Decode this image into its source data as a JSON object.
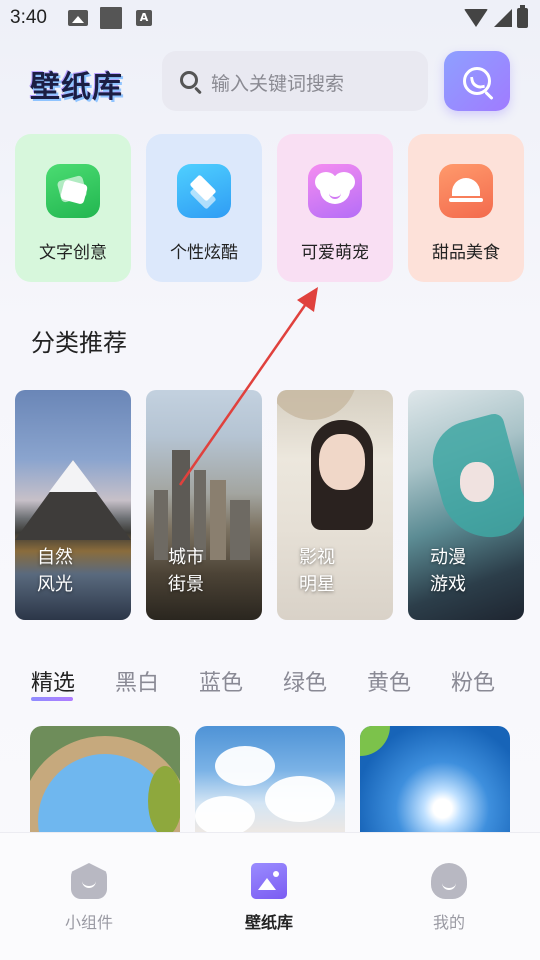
{
  "status_bar": {
    "time": "3:40",
    "icons": [
      "image-icon",
      "square-icon",
      "a-icon",
      "wifi-icon",
      "signal-icon",
      "battery-charging-icon"
    ]
  },
  "header": {
    "logo": "壁纸库",
    "search": {
      "placeholder": "输入关键词搜索"
    }
  },
  "categories": [
    {
      "label": "文字创意",
      "icon": "cards-icon",
      "bg": "#d7f7dc"
    },
    {
      "label": "个性炫酷",
      "icon": "layers-icon",
      "bg": "#dce8fb"
    },
    {
      "label": "可爱萌宠",
      "icon": "bear-icon",
      "bg": "#f9dff3"
    },
    {
      "label": "甜品美食",
      "icon": "dish-cover-icon",
      "bg": "#fde1d9"
    }
  ],
  "section": {
    "title": "分类推荐"
  },
  "recommend": [
    {
      "label": "自然\n风光"
    },
    {
      "label": "城市\n街景"
    },
    {
      "label": "影视\n明星"
    },
    {
      "label": "动漫\n游戏"
    }
  ],
  "tabs": [
    {
      "label": "精选",
      "active": true
    },
    {
      "label": "黑白",
      "active": false
    },
    {
      "label": "蓝色",
      "active": false
    },
    {
      "label": "绿色",
      "active": false
    },
    {
      "label": "黄色",
      "active": false
    },
    {
      "label": "粉色",
      "active": false
    }
  ],
  "bottom_nav": [
    {
      "label": "小组件",
      "icon": "widget-icon",
      "active": false
    },
    {
      "label": "壁纸库",
      "icon": "wallpaper-icon",
      "active": true
    },
    {
      "label": "我的",
      "icon": "profile-icon",
      "active": false
    }
  ],
  "colors": {
    "accent": "#8f7cff",
    "annotation_arrow": "#e0413d"
  }
}
